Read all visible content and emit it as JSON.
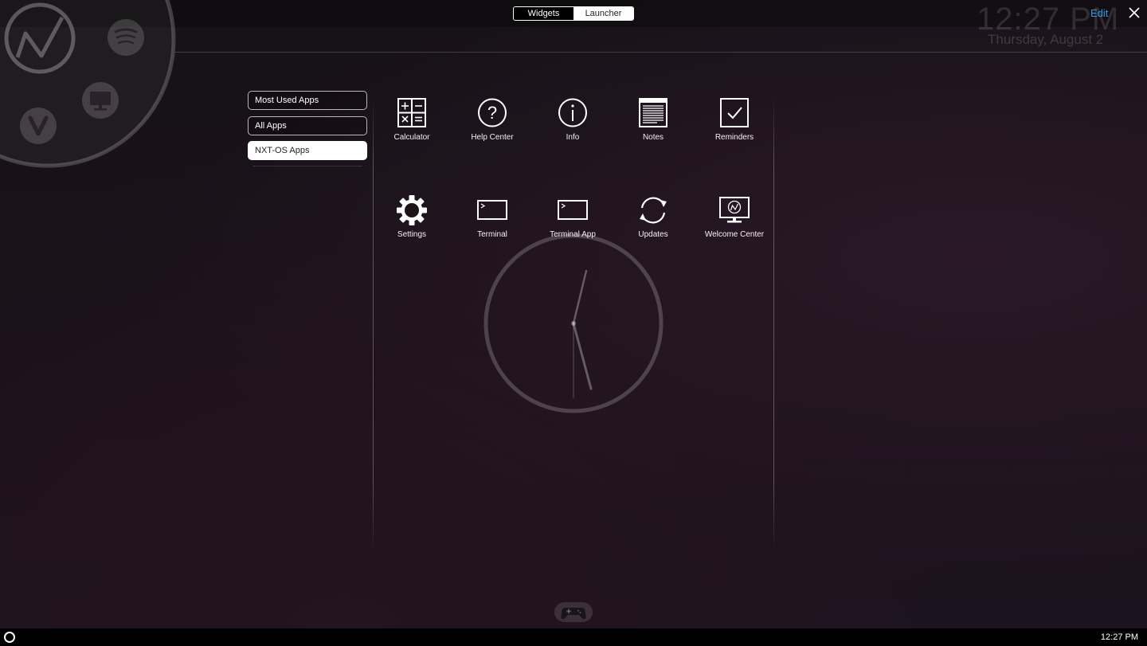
{
  "header": {
    "mode_tabs": [
      {
        "label": "Widgets",
        "active": false
      },
      {
        "label": "Launcher",
        "active": true
      }
    ],
    "clock_time": "12:27 PM",
    "clock_date": "Thursday, August 2",
    "edit_label": "Edit",
    "accent_color": "#2f9bea"
  },
  "dock": {
    "items": [
      "nxt-logo-icon",
      "spotify-icon",
      "monitor-icon",
      "vivaldi-icon"
    ]
  },
  "categories": [
    {
      "label": "Most Used Apps",
      "selected": false
    },
    {
      "label": "All Apps",
      "selected": false
    },
    {
      "label": "NXT-OS Apps",
      "selected": true
    }
  ],
  "apps": [
    {
      "label": "Calculator",
      "icon": "calculator-icon"
    },
    {
      "label": "Help Center",
      "icon": "question-circle-icon"
    },
    {
      "label": "Info",
      "icon": "info-circle-icon"
    },
    {
      "label": "Notes",
      "icon": "notes-icon"
    },
    {
      "label": "Reminders",
      "icon": "checkbox-icon"
    },
    {
      "label": "Settings",
      "icon": "gear-icon"
    },
    {
      "label": "Terminal",
      "icon": "terminal-icon"
    },
    {
      "label": "Terminal App",
      "icon": "terminal-icon"
    },
    {
      "label": "Updates",
      "icon": "refresh-icon"
    },
    {
      "label": "Welcome Center",
      "icon": "monitor-logo-icon"
    }
  ],
  "taskbar": {
    "time": "12:27 PM"
  }
}
